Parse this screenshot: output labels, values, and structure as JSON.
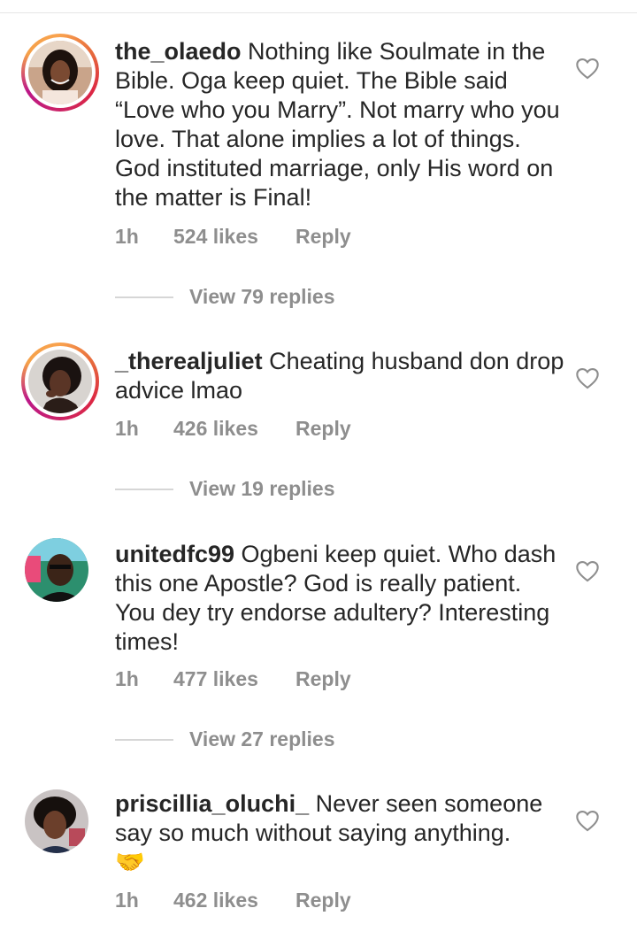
{
  "comments": [
    {
      "username": "the_olaedo",
      "text": " Nothing like Soulmate in the Bible. Oga keep quiet. The Bible said “Love who you Marry”. Not marry who you love. That alone implies a lot of things. God instituted marriage, only His word on the matter is Final!",
      "time": "1h",
      "likes": "524 likes",
      "reply": "Reply",
      "view_replies": "View 79 replies"
    },
    {
      "username": "_therealjuliet",
      "text": " Cheating husband don drop advice lmao",
      "time": "1h",
      "likes": "426 likes",
      "reply": "Reply",
      "view_replies": "View 19 replies"
    },
    {
      "username": "unitedfc99",
      "text": " Ogbeni keep quiet. Who dash this one Apostle? God is really patient. You dey try endorse adultery? Interesting times!",
      "time": "1h",
      "likes": "477 likes",
      "reply": "Reply",
      "view_replies": "View 27 replies"
    },
    {
      "username": "priscillia_oluchi_",
      "text": " Never seen someone say so much without saying anything.",
      "emoji": "🤝",
      "time": "1h",
      "likes": "462 likes",
      "reply": "Reply"
    }
  ],
  "icons": {
    "like": "heart-outline-icon"
  }
}
